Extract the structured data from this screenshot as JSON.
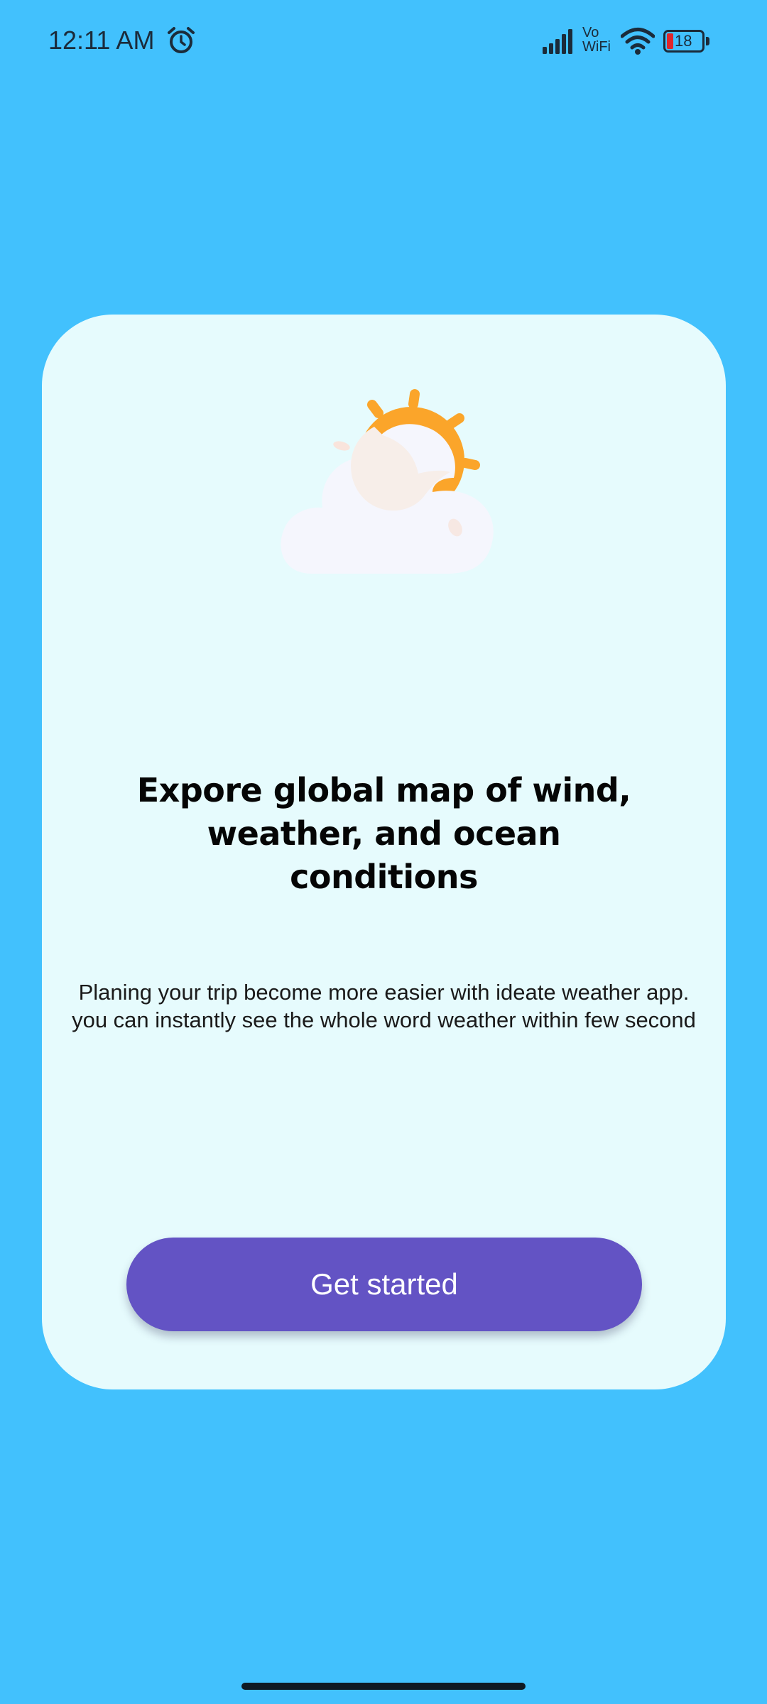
{
  "status_bar": {
    "time": "12:11 AM",
    "network_label": "Vo WiFi",
    "battery_level": "18",
    "icons": [
      "alarm-icon",
      "signal-icon",
      "wifi-icon",
      "battery-icon"
    ]
  },
  "onboarding": {
    "illustration": "sun-behind-cloud-icon",
    "headline": "Expore global map of wind, weather, and ocean conditions",
    "description": "Planing your trip become more easier with ideate weather app. you can instantly see the whole word weather within few second",
    "cta_label": "Get started"
  },
  "colors": {
    "background": "#42c1fd",
    "card": "#e6fbfd",
    "button": "#6353c4",
    "sun": "#fba52a"
  }
}
